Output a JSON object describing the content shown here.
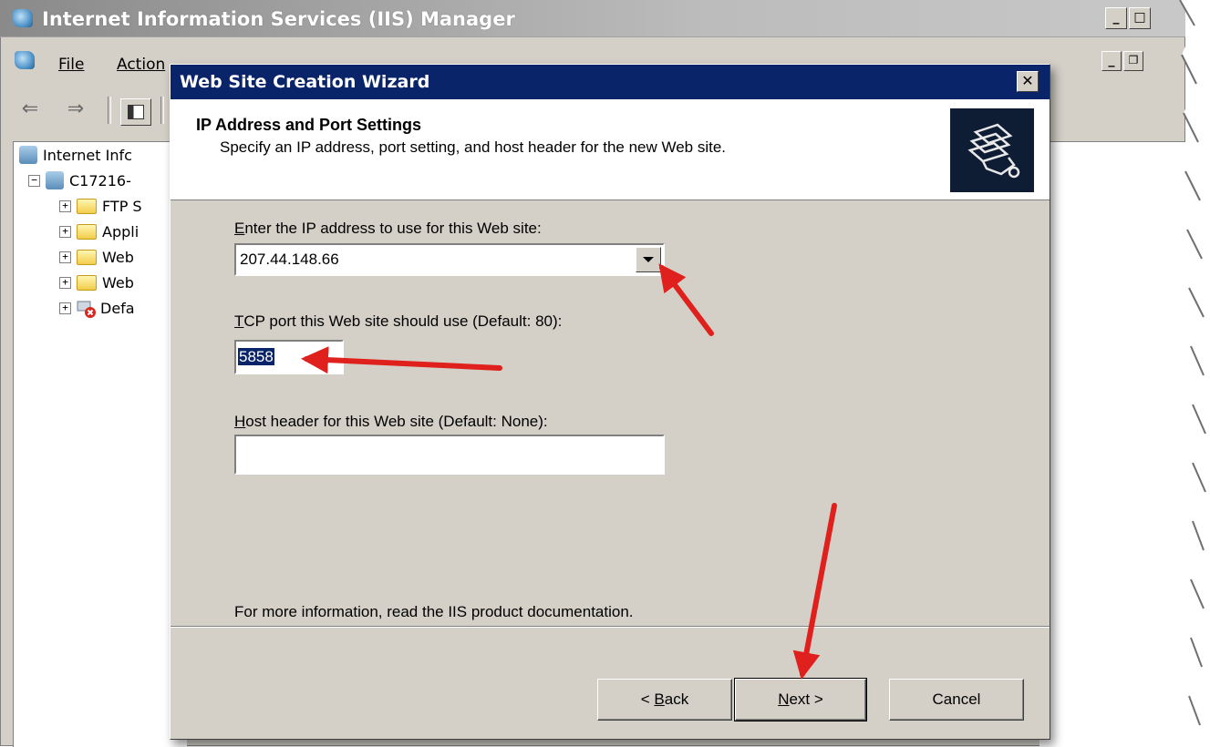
{
  "main_window": {
    "title": "Internet Information Services (IIS) Manager",
    "menu": {
      "file": "File",
      "action": "Action"
    },
    "tree": {
      "root": "Internet Infc",
      "server": "C17216-",
      "children": [
        "FTP S",
        "Appli",
        "Web",
        "Web",
        "Defa"
      ]
    }
  },
  "dialog": {
    "title": "Web Site Creation Wizard",
    "close_label": "✕",
    "header_title": "IP Address and Port Settings",
    "header_subtitle": "Specify an IP address, port setting, and host header for the new Web site.",
    "ip": {
      "label_access": "E",
      "label_rest": "nter the IP address to use for this Web site:",
      "value": "207.44.148.66"
    },
    "port": {
      "label_access": "T",
      "label_rest": "CP port this Web site should use (Default: 80):",
      "value": "5858"
    },
    "host": {
      "label_access": "H",
      "label_rest": "ost header for this Web site (Default: None):",
      "value": ""
    },
    "info_text": "For more information, read the IIS product documentation.",
    "buttons": {
      "back_prefix": "< ",
      "back_access": "B",
      "back_rest": "ack",
      "next_access": "N",
      "next_rest": "ext >",
      "cancel": "Cancel"
    }
  },
  "annotations": {
    "arrow_color": "#e0201c"
  }
}
